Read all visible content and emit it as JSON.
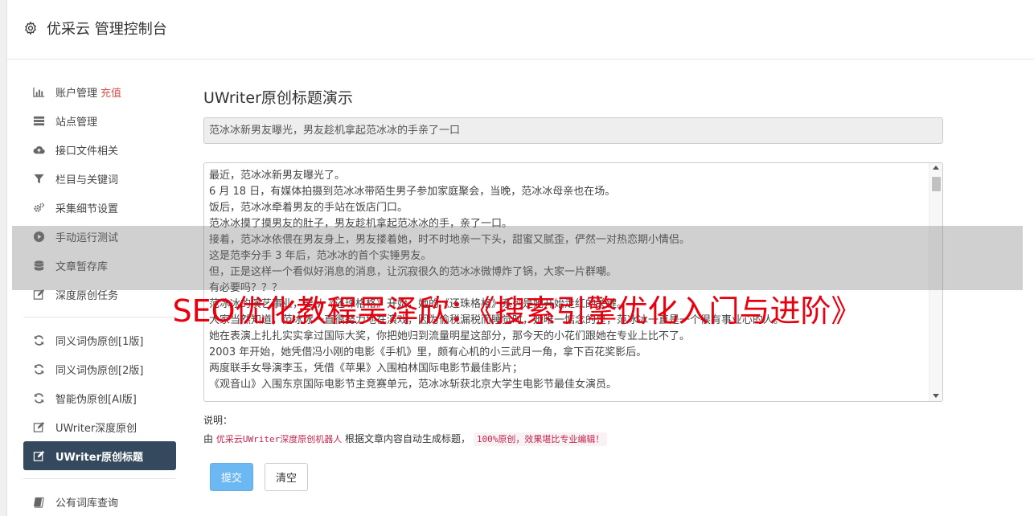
{
  "header": {
    "title": "优采云 管理控制台"
  },
  "sidebar": {
    "items": [
      {
        "label": "账户管理",
        "extra": "充值",
        "icon": "bar-chart-icon"
      },
      {
        "label": "站点管理",
        "icon": "server-icon"
      },
      {
        "label": "接口文件相关",
        "icon": "cloud-upload-icon"
      },
      {
        "label": "栏目与关键词",
        "icon": "filter-icon"
      },
      {
        "label": "采集细节设置",
        "icon": "cogs-icon"
      },
      {
        "label": "手动运行测试",
        "icon": "play-circle-icon"
      },
      {
        "label": "文章暂存库",
        "icon": "database-icon"
      },
      {
        "label": "深度原创任务",
        "icon": "edit-icon"
      },
      {
        "label": "同义词伪原创[1版]",
        "icon": "refresh-icon"
      },
      {
        "label": "同义词伪原创[2版]",
        "icon": "refresh-icon"
      },
      {
        "label": "智能伪原创[AI版]",
        "icon": "refresh-icon"
      },
      {
        "label": "UWriter深度原创",
        "icon": "edit-icon"
      },
      {
        "label": "UWriter原创标题",
        "icon": "edit-icon",
        "active": true
      },
      {
        "label": "公有词库查询",
        "icon": "book-icon"
      }
    ]
  },
  "main": {
    "title": "UWriter原创标题演示",
    "generated_title": "范冰冰新男友曝光，男友趁机拿起范冰冰的手亲了一口",
    "content_lines": [
      "最近，范冰冰新男友曝光了。",
      "6 月 18 日，有媒体拍摄到范冰冰带陌生男子参加家庭聚会，当晚，范冰冰母亲也在场。",
      "饭后，范冰冰牵着男友的手站在饭店门口。",
      "范冰冰摸了摸男友的肚子，男友趁机拿起范冰冰的手，亲了一口。",
      "接着，范冰冰依偎在男友身上，男友搂着她，时不时地亲一下头，甜蜜又腻歪，俨然一对热恋期小情侣。",
      "这是范李分手 3 年后，范冰冰的首个实锤男友。",
      "但，正是这样一个看似好消息的消息，让沉寂很久的范冰冰微博炸了锅，大家一片群嘲。",
      "有必要吗？？？",
      "范冰冰的演艺事业，要从《还珠格格》开始，她的《还珠格格》系列是她开始走红的关键。",
      "大家当然知道，范冰冰一直很努力地在演戏，因为偷税漏税而睡觉时，她唯一惦念的是，范冰冰一直是一个很有事业心的人。",
      "她在表演上扎扎实实拿过国际大奖，你把她归到流量明星这部分，那今天的小花们跟她在专业上比不了。",
      "2003 年开始，她凭借冯小刚的电影《手机》里，颇有心机的小三武月一角，拿下百花奖影后。",
      "两度联手女导演李玉，凭借《苹果》入围柏林国际电影节最佳影片；",
      "《观音山》入围东京国际电影节主竞赛单元，范冰冰斩获北京大学生电影节最佳女演员。"
    ],
    "desc_label": "说明：",
    "desc_prefix": "由",
    "desc_code1": "优采云UWriter深度原创机器人",
    "desc_middle": "根据文章内容自动生成标题，",
    "desc_code2": "100%原创，效果堪比专业编辑！",
    "submit_label": "提交",
    "clear_label": "清空"
  },
  "overlay": {
    "watermark": "SEO优化教程吴泽欣：《搜索引擎优化入门与进阶》"
  },
  "colors": {
    "active_nav": "#34495e",
    "submit_button": "#6cb8f2",
    "accent_red": "#d9534f",
    "watermark": "#e8000f"
  }
}
